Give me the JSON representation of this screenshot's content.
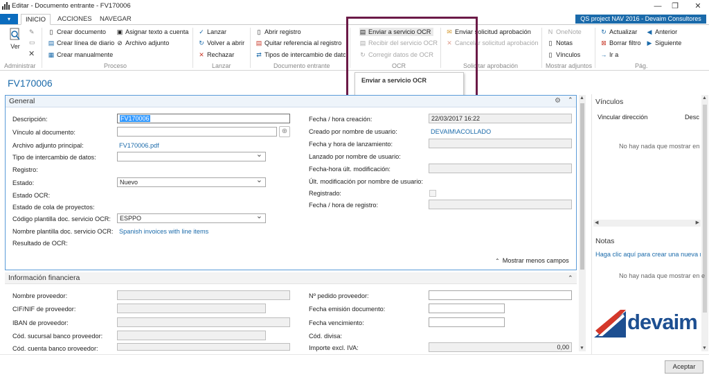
{
  "window": {
    "title": "Editar - Documento entrante - FV170006",
    "minimize_glyph": "—",
    "restore_glyph": "❐",
    "close_glyph": "✕"
  },
  "tabs": {
    "file_glyph": "▾",
    "items": [
      "INICIO",
      "ACCIONES",
      "NAVEGAR"
    ]
  },
  "company": "QS project NAV 2016 - Devaim Consultores",
  "ribbon": {
    "administrar": {
      "ver": "Ver",
      "group": "Administrar"
    },
    "proceso": {
      "crear_documento": "Crear documento",
      "crear_linea": "Crear línea de diario",
      "crear_manual": "Crear manualmente",
      "asignar_texto": "Asignar texto a cuenta",
      "archivo_adjunto": "Archivo adjunto",
      "group": "Proceso"
    },
    "lanzar": {
      "lanzar": "Lanzar",
      "volver_abrir": "Volver a abrir",
      "rechazar": "Rechazar",
      "group": "Lanzar"
    },
    "documento_entrante": {
      "abrir_registro": "Abrir registro",
      "quitar_referencia": "Quitar referencia al registro",
      "tipos_intercambio": "Tipos de intercambio de datos",
      "group": "Documento entrante"
    },
    "ocr": {
      "enviar": "Enviar a servicio OCR",
      "recibir": "Recibir del servicio OCR",
      "corregir": "Corregir datos de OCR",
      "group": "OCR"
    },
    "solicitar": {
      "enviar_solicitud": "Enviar solicitud aprobación",
      "cancelar_solicitud": "Cancelar solicitud aprobación",
      "group": "Solicitar aprobación"
    },
    "adjuntos": {
      "onenote": "OneNote",
      "notas": "Notas",
      "vinculos": "Vínculos",
      "group": "Mostrar adjuntos"
    },
    "pag": {
      "actualizar": "Actualizar",
      "borrar_filtro": "Borrar filtro",
      "ir_a": "Ir a",
      "anterior": "Anterior",
      "siguiente": "Siguiente",
      "group": "Pág."
    }
  },
  "tooltip": "Enviar a servicio OCR",
  "page_title": "FV170006",
  "general": {
    "title": "General",
    "left": {
      "descripcion": {
        "label": "Descripción:",
        "value": "FV170006"
      },
      "vinculo": {
        "label": "Vínculo al documento:",
        "value": ""
      },
      "archivo": {
        "label": "Archivo adjunto principal:",
        "value": "FV170006.pdf"
      },
      "tipo_intercambio": {
        "label": "Tipo de intercambio de datos:",
        "value": ""
      },
      "registro": {
        "label": "Registro:"
      },
      "estado": {
        "label": "Estado:",
        "value": "Nuevo"
      },
      "estado_ocr": {
        "label": "Estado OCR:"
      },
      "estado_cola": {
        "label": "Estado de cola de proyectos:"
      },
      "codigo_plantilla": {
        "label": "Código plantilla doc. servicio OCR:",
        "value": "ESPPO"
      },
      "nombre_plantilla": {
        "label": "Nombre plantilla doc. servicio OCR:",
        "value": "Spanish invoices with line items"
      },
      "resultado_ocr": {
        "label": "Resultado de OCR:"
      }
    },
    "right": {
      "fecha_creacion": {
        "label": "Fecha / hora creación:",
        "value": "22/03/2017 16:22"
      },
      "creado_por": {
        "label": "Creado por nombre de usuario:",
        "value": "DEVAIM\\ACOLLADO"
      },
      "fecha_lanzamiento": {
        "label": "Fecha y hora de lanzamiento:",
        "value": ""
      },
      "lanzado_por": {
        "label": "Lanzado por nombre de usuario:"
      },
      "fecha_ult_mod": {
        "label": "Fecha-hora últ. modificación:",
        "value": ""
      },
      "ult_mod_por": {
        "label": "Últ. modificación por nombre de usuario:"
      },
      "registrado": {
        "label": "Registrado:"
      },
      "fecha_registro": {
        "label": "Fecha / hora de registro:",
        "value": ""
      }
    },
    "mostrar_menos": "Mostrar menos campos"
  },
  "financiera": {
    "title": "Información financiera",
    "left": {
      "nombre_proveedor": "Nombre proveedor:",
      "cif_nif": "CIF/NIF de proveedor:",
      "iban": "IBAN de proveedor:",
      "cod_sucursal": "Cód. sucursal banco proveedor:",
      "cod_cuenta": "Cód. cuenta banco proveedor:"
    },
    "right": {
      "pedido_proveedor": "Nº pedido proveedor:",
      "fecha_emision": "Fecha emisión documento:",
      "fecha_vencimiento": "Fecha vencimiento:",
      "cod_divisa": "Cód. divisa:",
      "importe_excl": {
        "label": "Importe excl. IVA:",
        "value": "0,00"
      }
    }
  },
  "factbox": {
    "vinculos": {
      "title": "Vínculos",
      "col_link": "Vincular dirección",
      "col_desc": "Desc",
      "empty": "No hay nada que mostrar en e"
    },
    "notas": {
      "title": "Notas",
      "create_link": "Haga clic aquí para crear una nueva no",
      "empty": "No hay nada que mostrar en e"
    },
    "logo_text": "devaim"
  },
  "footer": {
    "aceptar": "Aceptar"
  },
  "colors": {
    "accent": "#1a6aaa",
    "highlight_box": "#6b1a47",
    "logo_blue": "#1d4f91",
    "logo_red": "#d4382a"
  }
}
